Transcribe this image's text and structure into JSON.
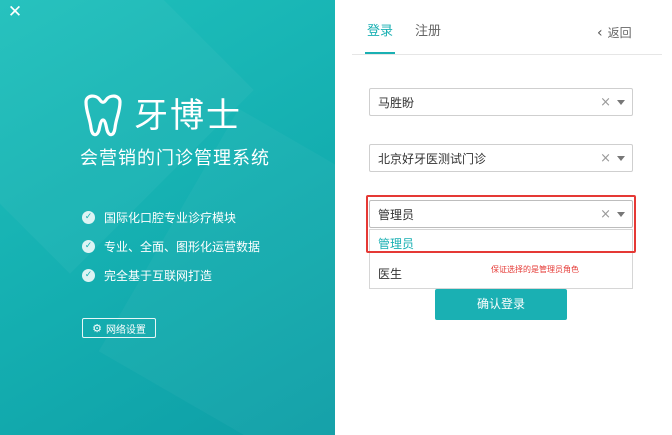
{
  "window": {
    "close_symbol": "✕"
  },
  "brand": {
    "name": "牙博士",
    "slogan": "会营销的门诊管理系统",
    "logo_icon": "tooth-icon",
    "features": [
      "国际化口腔专业诊疗模块",
      "专业、全面、图形化运营数据",
      "完全基于互联网打造"
    ],
    "network_settings_label": "网络设置"
  },
  "tabs": [
    {
      "label": "登录",
      "active": true
    },
    {
      "label": "注册",
      "active": false
    }
  ],
  "back_label": "返回",
  "form": {
    "user": {
      "value": "马胜盼"
    },
    "clinic": {
      "value": "北京好牙医测试门诊"
    },
    "role": {
      "value": "管理员",
      "options": [
        "管理员",
        "医生"
      ]
    },
    "login_label": "确认登录"
  },
  "annotation": {
    "note": "保证选择的是管理员角色"
  },
  "colors": {
    "brand_teal": "#1ab0b3",
    "highlight_red": "#e53935",
    "panel_gradient_start": "#1fc0bc",
    "panel_gradient_end": "#0e9ea6"
  }
}
